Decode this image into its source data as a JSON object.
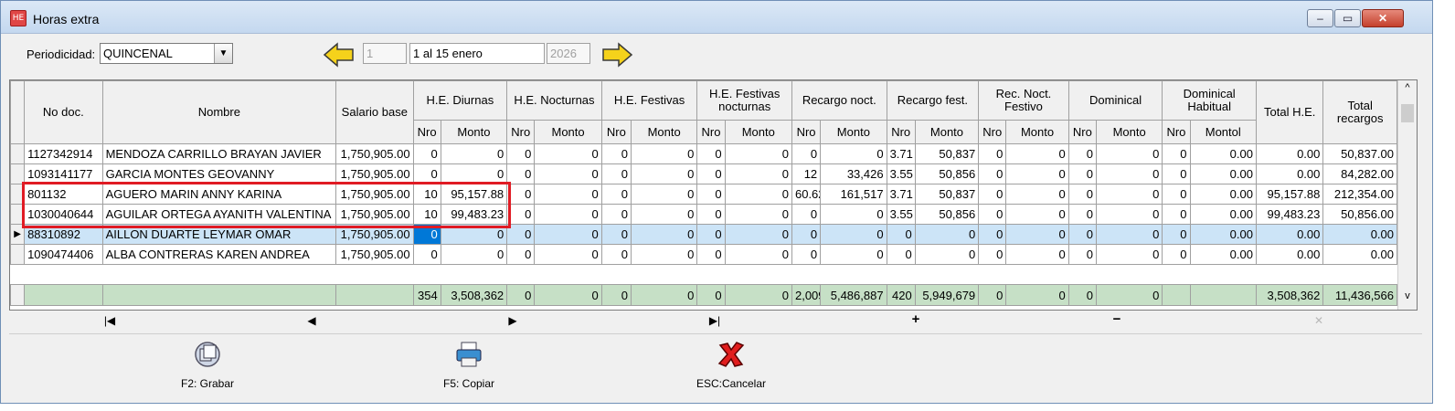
{
  "window": {
    "title": "Horas extra",
    "app_icon_text": "HE"
  },
  "toolbar": {
    "periodicidad_label": "Periodicidad:",
    "periodicidad_value": "QUINCENAL",
    "period_number": "1",
    "period_name": "1 al 15 enero",
    "year": "2026"
  },
  "grid": {
    "headers": {
      "no_doc": "No doc.",
      "nombre": "Nombre",
      "salario_base": "Salario base",
      "he_diurnas": "H.E. Diurnas",
      "he_nocturnas": "H.E. Nocturnas",
      "he_festivas": "H.E. Festivas",
      "he_festivas_nocturnas": "H.E. Festivas nocturnas",
      "recargo_noct": "Recargo noct.",
      "recargo_fest": "Recargo fest.",
      "rec_noct_festivo": "Rec. Noct. Festivo",
      "dominical": "Dominical",
      "dominical_habitual": "Dominical Habitual",
      "total_he": "Total H.E.",
      "total_recargos": "Total recargos",
      "nro": "Nro",
      "monto": "Monto",
      "montol": "Montol"
    },
    "rows": [
      [
        "1127342914",
        "MENDOZA CARRILLO BRAYAN JAVIER",
        "1,750,905.00",
        "0",
        "0",
        "0",
        "0",
        "0",
        "0",
        "0",
        "0",
        "0",
        "0",
        "3.71",
        "50,837",
        "0",
        "0",
        "0",
        "0",
        "0",
        "0.00",
        "0.00",
        "50,837.00"
      ],
      [
        "1093141177",
        "GARCIA MONTES GEOVANNY",
        "1,750,905.00",
        "0",
        "0",
        "0",
        "0",
        "0",
        "0",
        "0",
        "0",
        "12",
        "33,426",
        "3.55",
        "50,856",
        "0",
        "0",
        "0",
        "0",
        "0",
        "0.00",
        "0.00",
        "84,282.00"
      ],
      [
        "801132",
        "AGUERO MARIN ANNY KARINA",
        "1,750,905.00",
        "10",
        "95,157.88",
        "0",
        "0",
        "0",
        "0",
        "0",
        "0",
        "60.62",
        "161,517",
        "3.71",
        "50,837",
        "0",
        "0",
        "0",
        "0",
        "0",
        "0.00",
        "95,157.88",
        "212,354.00"
      ],
      [
        "1030040644",
        "AGUILAR ORTEGA AYANITH VALENTINA",
        "1,750,905.00",
        "10",
        "99,483.23",
        "0",
        "0",
        "0",
        "0",
        "0",
        "0",
        "0",
        "0",
        "3.55",
        "50,856",
        "0",
        "0",
        "0",
        "0",
        "0",
        "0.00",
        "99,483.23",
        "50,856.00"
      ],
      [
        "88310892",
        "AILLON DUARTE LEYMAR OMAR",
        "1,750,905.00",
        "0",
        "0",
        "0",
        "0",
        "0",
        "0",
        "0",
        "0",
        "0",
        "0",
        "0",
        "0",
        "0",
        "0",
        "0",
        "0",
        "0",
        "0.00",
        "0.00",
        "0.00"
      ],
      [
        "1090474406",
        "ALBA CONTRERAS KAREN ANDREA",
        "1,750,905.00",
        "0",
        "0",
        "0",
        "0",
        "0",
        "0",
        "0",
        "0",
        "0",
        "0",
        "0",
        "0",
        "0",
        "0",
        "0",
        "0",
        "0",
        "0.00",
        "0.00",
        "0.00"
      ]
    ],
    "totals": [
      "",
      "",
      "",
      "354",
      "3,508,362",
      "0",
      "0",
      "0",
      "0",
      "0",
      "0",
      "2,009",
      "5,486,887",
      "420",
      "5,949,679",
      "0",
      "0",
      "0",
      "0",
      "",
      "",
      "3,508,362",
      "11,436,566"
    ]
  },
  "navigator": {
    "first": "first-record-icon",
    "prior": "prior-record-icon",
    "next": "next-record-icon",
    "last": "last-record-icon",
    "insert": "insert-record-icon",
    "delete": "delete-record-icon",
    "cancel_edit": "cancel-edit-icon"
  },
  "buttons": {
    "grabar": "F2: Grabar",
    "copiar": "F5: Copiar",
    "cancelar": "ESC:Cancelar"
  },
  "colors": {
    "selection_row": "#cce4f7",
    "current_cell": "#0078d7",
    "totals_row": "#c6e0c6",
    "highlight_box": "#e01b24",
    "arrow_yellow": "#f5d21b"
  }
}
